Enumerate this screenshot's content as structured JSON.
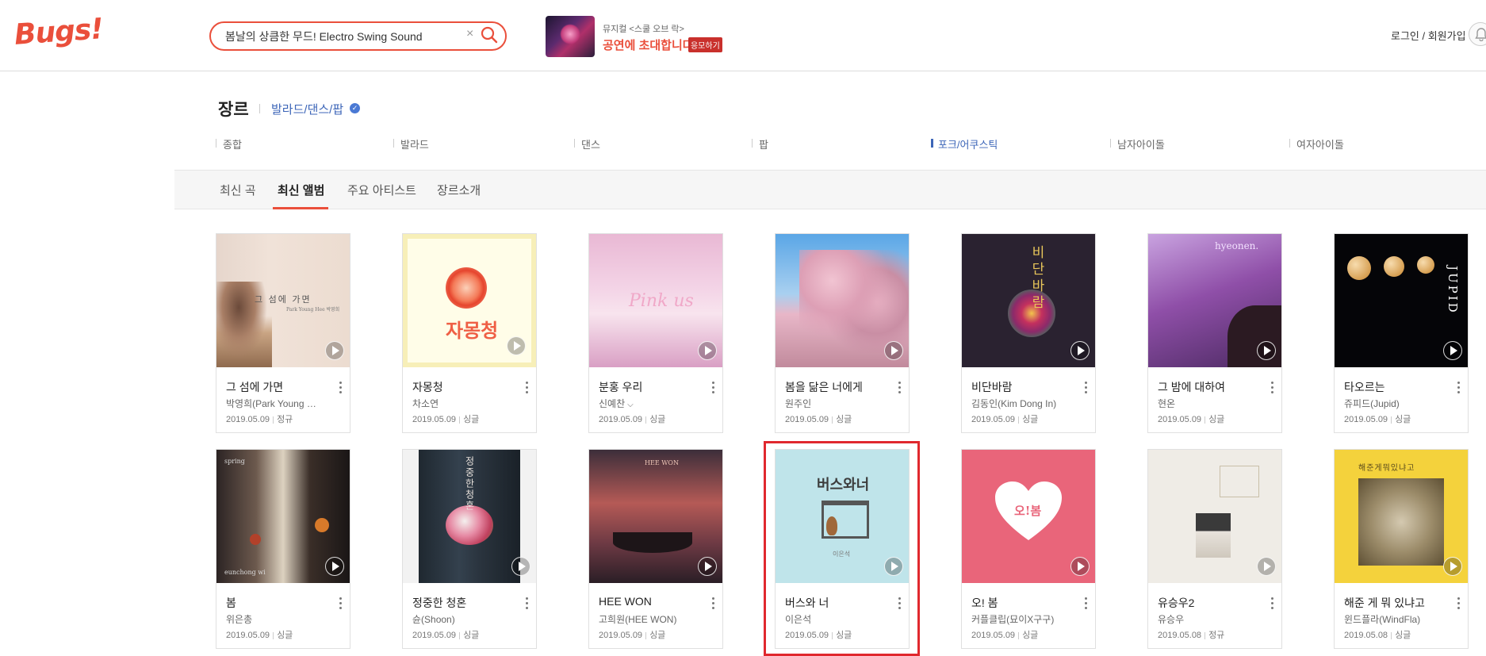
{
  "header": {
    "logo": "Bugs!",
    "search_value": "봄날의 상큼한 무드! Electro Swing Sound",
    "clear_glyph": "×",
    "promo_small": "뮤지컬 <스쿨 오브 락>",
    "promo_big": "공연에 초대합니다!",
    "promo_badge": "응모하기",
    "login": "로그인 / 회원가입"
  },
  "genre": {
    "title": "장르",
    "current": "발라드/댄스/팝",
    "subgenres": [
      "종합",
      "발라드",
      "댄스",
      "팝",
      "포크/어쿠스틱",
      "남자아이돌",
      "여자아이돌"
    ],
    "active_subgenre": "포크/어쿠스틱"
  },
  "tabs": [
    "최신 곡",
    "최신 앨범",
    "주요 아티스트",
    "장르소개"
  ],
  "active_tab": "최신 앨범",
  "cover_text": {
    "a1": "그 섬에 가면",
    "a1_sub": "Park Young Hee 박영희",
    "a2": "자몽청",
    "a3": "Pink us",
    "a5": "비단바람",
    "a6": "hyeonen.",
    "a7": "JUPID",
    "a8_top": "spring",
    "a8_bottom": "eunchong wi",
    "a9": "정중한청혼",
    "a10": "HEE WON",
    "a11": "버스와너",
    "a11_sub": "이은석",
    "a12": "오!봄",
    "a14": "해준게뭐있냐고"
  },
  "albums": [
    {
      "title": "그 섬에 가면",
      "artist": "박영희(Park Young Hee)",
      "date": "2019.05.09",
      "type": "정규"
    },
    {
      "title": "자몽청",
      "artist": "차소연",
      "date": "2019.05.09",
      "type": "싱글"
    },
    {
      "title": "분홍 우리",
      "artist": "신예찬",
      "date": "2019.05.09",
      "type": "싱글"
    },
    {
      "title": "봄을 닮은 너에게",
      "artist": "원주인",
      "date": "2019.05.09",
      "type": "싱글"
    },
    {
      "title": "비단바람",
      "artist": "김동인(Kim Dong In)",
      "date": "2019.05.09",
      "type": "싱글"
    },
    {
      "title": "그 밤에 대하여",
      "artist": "현온",
      "date": "2019.05.09",
      "type": "싱글"
    },
    {
      "title": "타오르는",
      "artist": "쥬피드(Jupid)",
      "date": "2019.05.09",
      "type": "싱글"
    },
    {
      "title": "봄",
      "artist": "위은총",
      "date": "2019.05.09",
      "type": "싱글"
    },
    {
      "title": "정중한 청혼",
      "artist": "슌(Shoon)",
      "date": "2019.05.09",
      "type": "싱글"
    },
    {
      "title": "HEE WON",
      "artist": "고희원(HEE WON)",
      "date": "2019.05.09",
      "type": "싱글"
    },
    {
      "title": "버스와 너",
      "artist": "이은석",
      "date": "2019.05.09",
      "type": "싱글"
    },
    {
      "title": "오! 봄",
      "artist": "커플클립(묘이X구구)",
      "date": "2019.05.09",
      "type": "싱글"
    },
    {
      "title": "유승우2",
      "artist": "유승우",
      "date": "2019.05.08",
      "type": "정규"
    },
    {
      "title": "해준 게 뭐 있냐고",
      "artist": "윈드플라(WindFla)",
      "date": "2019.05.08",
      "type": "싱글"
    }
  ],
  "colors": {
    "brand": "#ea4f3b",
    "link_blue": "#3d66b8",
    "highlight_red": "#e0282e"
  },
  "icons": [
    "search-icon",
    "bell-icon",
    "check-circle-icon",
    "play-icon",
    "more-icon",
    "chevron-down-icon"
  ]
}
